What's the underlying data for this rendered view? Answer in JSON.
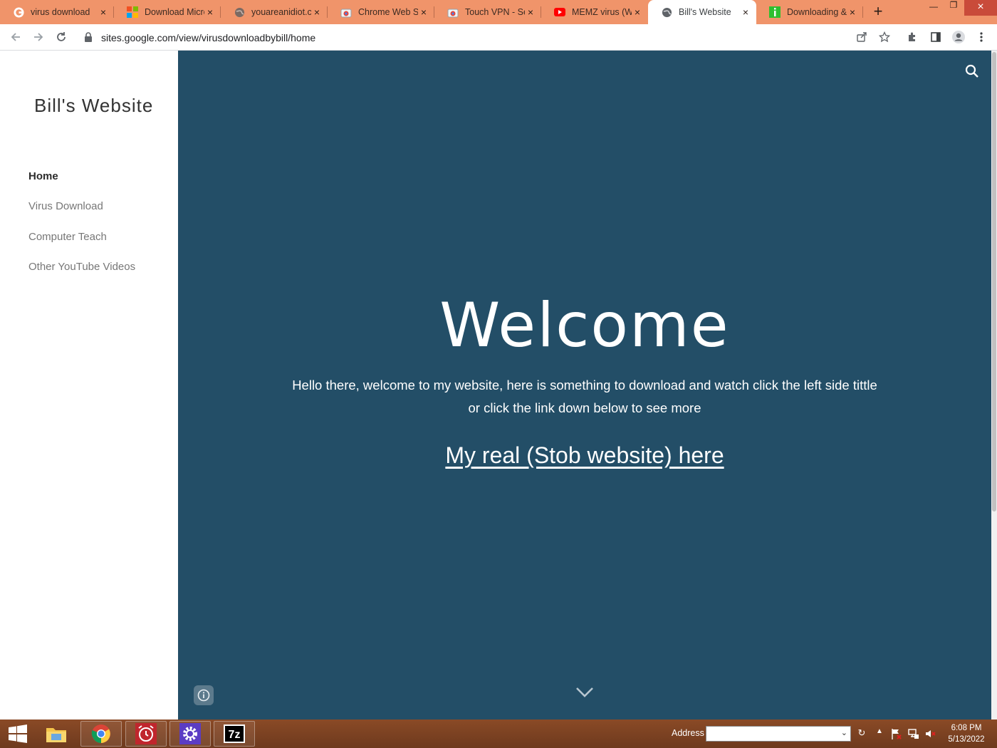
{
  "browser": {
    "tabs": [
      {
        "title": "virus download",
        "favicon": "google-icon"
      },
      {
        "title": "Download Micro",
        "favicon": "microsoft-icon"
      },
      {
        "title": "youareanidiot.c",
        "favicon": "globe-icon"
      },
      {
        "title": "Chrome Web St",
        "favicon": "chrome-web-store-icon"
      },
      {
        "title": "Touch VPN - Se",
        "favicon": "chrome-web-store-icon"
      },
      {
        "title": "MEMZ virus (W",
        "favicon": "youtube-icon"
      },
      {
        "title": "Bill's Website",
        "favicon": "globe-icon",
        "active": true
      },
      {
        "title": "Downloading &",
        "favicon": "download-info-icon"
      }
    ],
    "url": "sites.google.com/view/virusdownloadbybill/home"
  },
  "site": {
    "title": "Bill's Website",
    "nav": [
      {
        "label": "Home",
        "active": true
      },
      {
        "label": "Virus Download"
      },
      {
        "label": "Computer Teach"
      },
      {
        "label": "Other YouTube Videos"
      }
    ],
    "hero": {
      "heading": "Welcome",
      "intro_line1": "Hello there, welcome to my website, here is something to download and watch click the left side tittle",
      "intro_line2": "or click the link down below to see more",
      "link": "My real (Stob website) here",
      "background": "#234e67"
    }
  },
  "taskbar": {
    "address_label": "Address",
    "address_value": "",
    "time": "6:08 PM",
    "date": "5/13/2022",
    "apps": [
      "windows-start-icon",
      "file-explorer-icon",
      "chrome-icon",
      "alarm-clock-icon",
      "settings-gear-icon",
      "7zip-icon"
    ]
  }
}
